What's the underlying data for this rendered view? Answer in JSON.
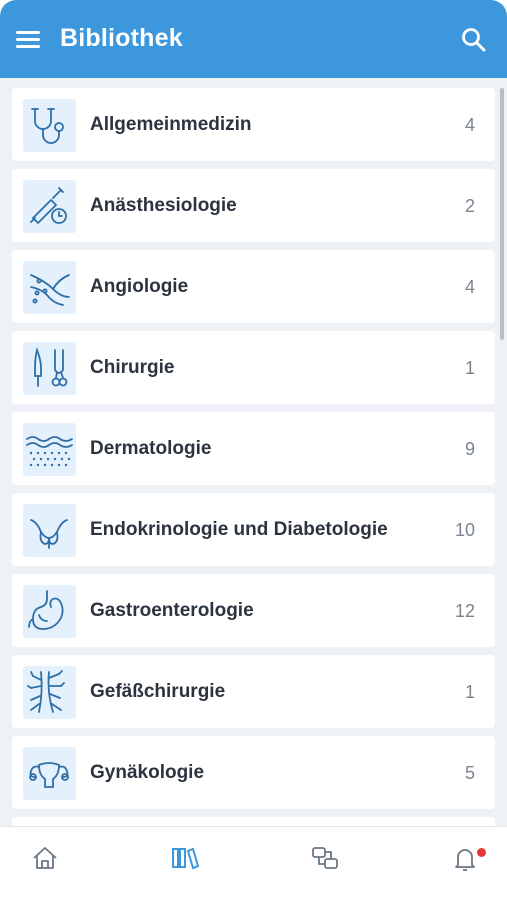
{
  "header": {
    "title": "Bibliothek",
    "menu_icon": "hamburger-menu-icon",
    "search_icon": "search-icon"
  },
  "categories": [
    {
      "label": "Allgemeinmedizin",
      "count": "4",
      "icon": "stethoscope-icon"
    },
    {
      "label": "Anästhesiologie",
      "count": "2",
      "icon": "syringe-clock-icon"
    },
    {
      "label": "Angiologie",
      "count": "4",
      "icon": "blood-vessel-icon"
    },
    {
      "label": "Chirurgie",
      "count": "1",
      "icon": "surgical-instruments-icon"
    },
    {
      "label": "Dermatologie",
      "count": "9",
      "icon": "skin-layers-icon"
    },
    {
      "label": "Endokrinologie und Diabetologie",
      "count": "10",
      "icon": "thyroid-icon"
    },
    {
      "label": "Gastroenterologie",
      "count": "12",
      "icon": "stomach-icon"
    },
    {
      "label": "Gefäßchirurgie",
      "count": "1",
      "icon": "vessel-network-icon"
    },
    {
      "label": "Gynäkologie",
      "count": "5",
      "icon": "uterus-icon"
    }
  ],
  "bottom_nav": [
    {
      "name": "home",
      "icon": "home-icon",
      "active": false
    },
    {
      "name": "library",
      "icon": "library-books-icon",
      "active": true
    },
    {
      "name": "cases",
      "icon": "cases-icon",
      "active": false
    },
    {
      "name": "notifications",
      "icon": "bell-icon",
      "active": false,
      "badge": true
    }
  ],
  "colors": {
    "primary": "#3d97dd",
    "background": "#eef1f5",
    "icon_bg": "#e4f0fb",
    "icon_stroke": "#2f6fa8",
    "text": "#2c3440",
    "count_text": "#7a8591",
    "nav_inactive": "#6b7785",
    "badge": "#e53935"
  }
}
